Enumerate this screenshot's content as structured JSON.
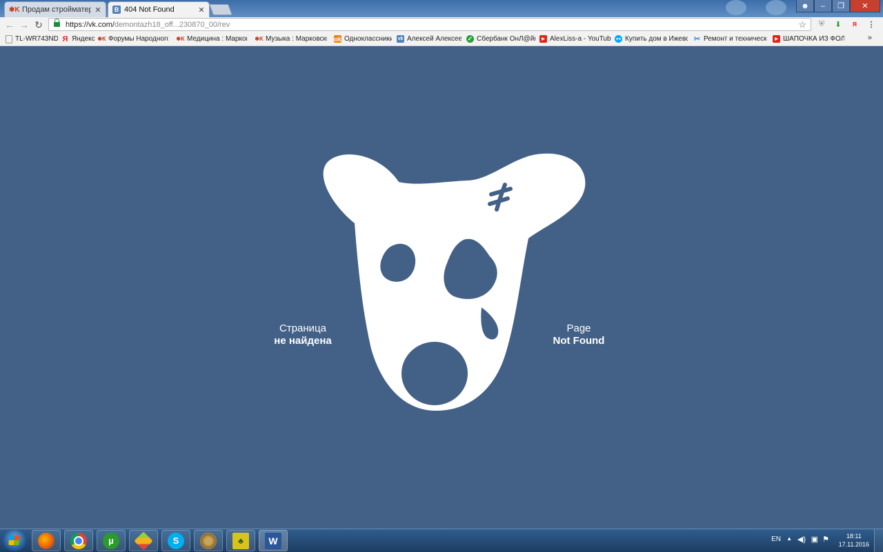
{
  "tabs": [
    {
      "label": "Продам стройматериал",
      "active": false,
      "favicon": "nk-icon"
    },
    {
      "label": "404 Not Found",
      "active": true,
      "favicon": "vk-icon"
    }
  ],
  "address_bar": {
    "url_host": "https://vk.com/",
    "url_path": "demontazh18_off...230870_00/rev"
  },
  "bookmarks": [
    {
      "label": "TL-WR743ND",
      "icon": "page-icon"
    },
    {
      "label": "Яндекс",
      "icon": "yandex-icon"
    },
    {
      "label": "Форумы Народного",
      "icon": "nk-icon"
    },
    {
      "label": "Медицина : Марков",
      "icon": "nk-icon"
    },
    {
      "label": "Музыка : Марковски",
      "icon": "nk-icon"
    },
    {
      "label": "Одноклассники",
      "icon": "ok-icon"
    },
    {
      "label": "Алексей Алексеев",
      "icon": "vk-icon"
    },
    {
      "label": "Сбербанк ОнЛ@йн",
      "icon": "sberbank-icon"
    },
    {
      "label": "AlexLiss-a - YouTube",
      "icon": "youtube-icon"
    },
    {
      "label": "Купить дом в Ижевс",
      "icon": "avito-icon"
    },
    {
      "label": "Ремонт и техническо",
      "icon": "tools-icon"
    },
    {
      "label": "ШАПОЧКА ИЗ ФОЛЬ",
      "icon": "youtube-icon"
    }
  ],
  "bookmarks_more": "»",
  "page": {
    "text_ru_line1": "Страница",
    "text_ru_line2": "не найдена",
    "text_en_line1": "Page",
    "text_en_line2": "Not Found"
  },
  "taskbar": {
    "apps": [
      "firefox-icon",
      "chrome-icon",
      "utorrent-icon",
      "bluestacks-icon",
      "skype-icon",
      "app-circle-icon",
      "app-tree-icon",
      "word-icon"
    ],
    "language": "EN",
    "time": "18:11",
    "date": "17.11.2016"
  },
  "colors": {
    "page_bg": "#436086",
    "mascot": "#ffffff"
  }
}
